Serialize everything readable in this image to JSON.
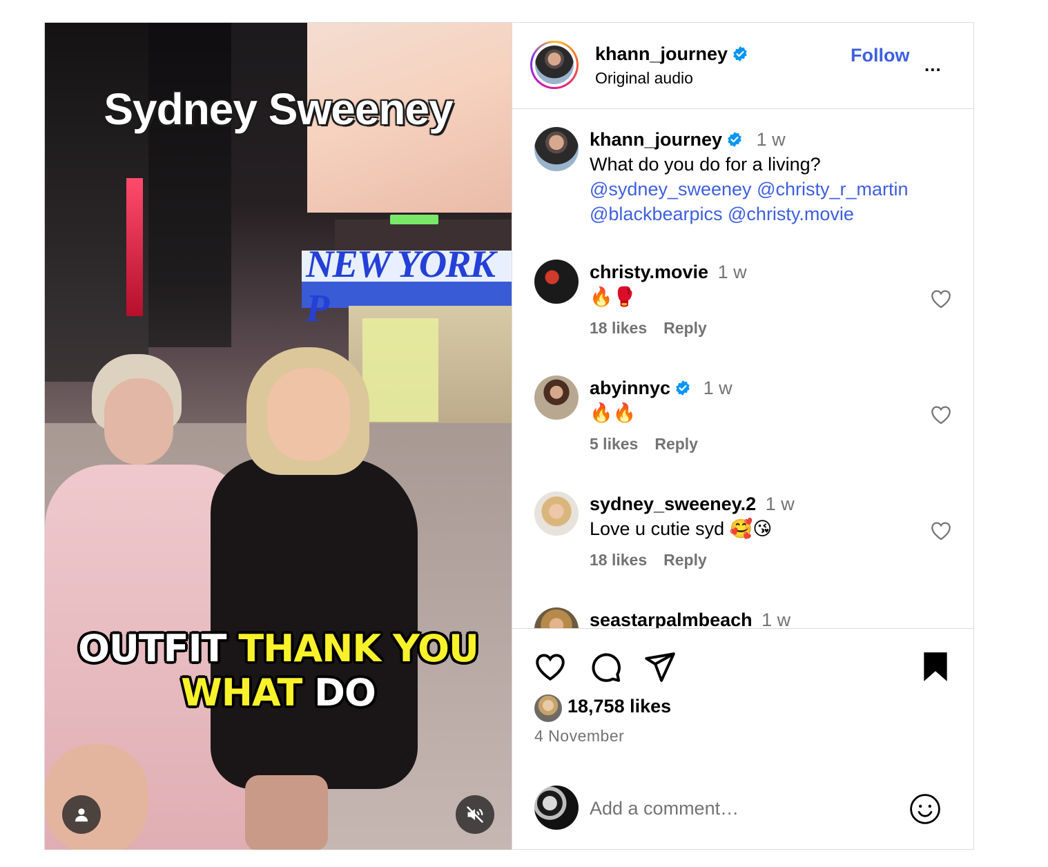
{
  "media": {
    "title_overlay": "Sydney Sweeney",
    "sign_text": "NEW YORK P",
    "caption_white_1": "OUTFIT",
    "caption_yellow_1": "THANK YOU",
    "caption_yellow_2": "WHAT",
    "caption_white_2": "DO"
  },
  "header": {
    "username": "khann_journey",
    "audio": "Original audio",
    "follow_label": "Follow",
    "more_label": "..."
  },
  "caption": {
    "username": "khann_journey",
    "time": "1 w",
    "text": "What do you do for a living?",
    "mentions": [
      "@sydney_sweeney",
      "@christy_r_martin",
      "@blackbearpics",
      "@christy.movie"
    ]
  },
  "comments": [
    {
      "username": "christy.movie",
      "time": "1 w",
      "text": "🔥🥊",
      "likes": "18 likes",
      "reply": "Reply"
    },
    {
      "username": "abyinnyc",
      "time": "1 w",
      "text": "🔥🔥",
      "likes": "5 likes",
      "reply": "Reply"
    },
    {
      "username": "sydney_sweeney.2",
      "time": "1 w",
      "text": "Love u cutie syd 🥰😘",
      "likes": "18 likes",
      "reply": "Reply"
    },
    {
      "username": "seastarpalmbeach",
      "time": "1 w"
    }
  ],
  "footer": {
    "likes": "18,758 likes",
    "date": "4 November",
    "comment_placeholder": "Add a comment…"
  },
  "icons": {
    "like": "heart-icon",
    "comment": "comment-icon",
    "share": "share-icon",
    "save": "bookmark-icon",
    "emoji": "emoji-icon",
    "verified": "verified-badge-icon",
    "user": "user-icon",
    "mute": "muted-speaker-icon"
  },
  "colors": {
    "link": "#3d5fe0",
    "verified": "#0095f6",
    "secondary_text": "#737373",
    "caption_yellow": "#f8f22a"
  }
}
